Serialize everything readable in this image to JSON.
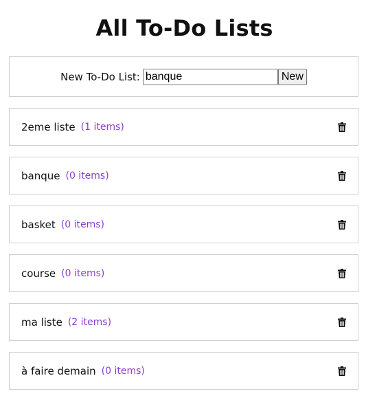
{
  "page": {
    "title": "All To-Do Lists"
  },
  "new_list_form": {
    "label": "New To-Do List:",
    "input_value": "banque",
    "button_label": "New"
  },
  "lists": [
    {
      "name": "2eme liste",
      "count": "(1 items)"
    },
    {
      "name": "banque",
      "count": "(0 items)"
    },
    {
      "name": "basket",
      "count": "(0 items)"
    },
    {
      "name": "course",
      "count": "(0 items)"
    },
    {
      "name": "ma liste",
      "count": "(2 items)"
    },
    {
      "name": "à faire demain",
      "count": "(0 items)"
    }
  ],
  "icons": {
    "delete": "trash-icon"
  },
  "colors": {
    "count_text": "#8a3fc7",
    "border": "#cfcfcf"
  }
}
